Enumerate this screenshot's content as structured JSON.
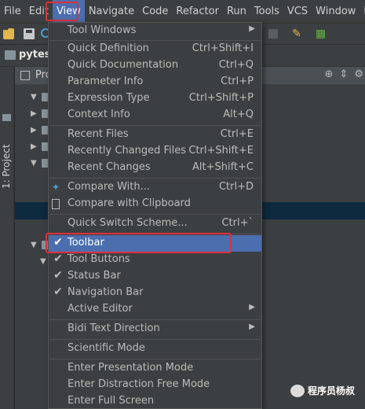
{
  "menubar": {
    "items": [
      "File",
      "Edit",
      "View",
      "Navigate",
      "Code",
      "Refactor",
      "Run",
      "Tools",
      "VCS",
      "Window",
      "He"
    ]
  },
  "navbar": {
    "project": "pytest"
  },
  "strip": {
    "label": "1: Project"
  },
  "panel": {
    "title": "Pro"
  },
  "view_menu": {
    "items": [
      {
        "label": "Tool Windows",
        "submenu": true
      },
      {
        "label": "Quick Definition",
        "shortcut": "Ctrl+Shift+I"
      },
      {
        "label": "Quick Documentation",
        "shortcut": "Ctrl+Q"
      },
      {
        "label": "Parameter Info",
        "shortcut": "Ctrl+P"
      },
      {
        "label": "Expression Type",
        "shortcut": "Ctrl+Shift+P"
      },
      {
        "label": "Context Info",
        "shortcut": "Alt+Q"
      },
      {
        "label": "Recent Files",
        "shortcut": "Ctrl+E"
      },
      {
        "label": "Recently Changed Files",
        "shortcut": "Ctrl+Shift+E"
      },
      {
        "label": "Recent Changes",
        "shortcut": "Alt+Shift+C"
      },
      {
        "label": "Compare With...",
        "shortcut": "Ctrl+D"
      },
      {
        "label": "Compare with Clipboard"
      },
      {
        "label": "Quick Switch Scheme...",
        "shortcut": "Ctrl+`"
      },
      {
        "label": "Toolbar",
        "checked": true
      },
      {
        "label": "Tool Buttons",
        "checked": true
      },
      {
        "label": "Status Bar",
        "checked": true
      },
      {
        "label": "Navigation Bar",
        "checked": true
      },
      {
        "label": "Active Editor",
        "submenu": true
      },
      {
        "label": "Bidi Text Direction",
        "submenu": true
      },
      {
        "label": "Scientific Mode"
      },
      {
        "label": "Enter Presentation Mode"
      },
      {
        "label": "Enter Distraction Free Mode"
      },
      {
        "label": "Enter Full Screen"
      }
    ]
  },
  "icons": {
    "check": "check-icon",
    "submenu": "chevron-right-icon"
  },
  "colors": {
    "selection": "#4b6eaf",
    "highlight_box": "#e0303a",
    "menu_bg": "#3c3f41"
  },
  "watermark": {
    "text": "程序员杨叔"
  }
}
